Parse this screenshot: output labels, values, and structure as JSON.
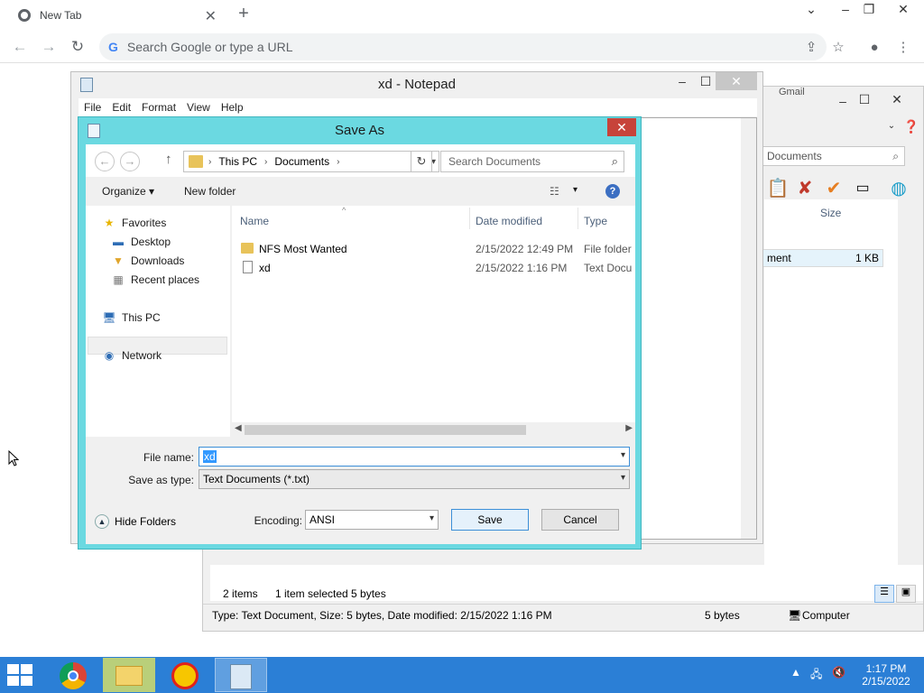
{
  "chrome": {
    "tab_title": "New Tab",
    "omnibox_placeholder": "Search Google or type a URL",
    "customize_label": "Customize Chrome",
    "partial_text": "Gmail"
  },
  "explorer": {
    "search_text": "Documents",
    "col_size": "Size",
    "row_name": "ment",
    "row_size": "1 KB",
    "items_count": "2 items",
    "selection": "1 item selected  5 bytes",
    "status_type": "Type: Text Document, Size: 5 bytes, Date modified: 2/15/2022 1:16 PM",
    "status_size": "5 bytes",
    "status_location": "Computer"
  },
  "notepad": {
    "title": "xd - Notepad",
    "menu": [
      "File",
      "Edit",
      "Format",
      "View",
      "Help"
    ]
  },
  "saveas": {
    "title": "Save As",
    "breadcrumb": [
      "This PC",
      "Documents"
    ],
    "search_placeholder": "Search Documents",
    "organize": "Organize",
    "new_folder": "New folder",
    "tree": {
      "favorites": "Favorites",
      "desktop": "Desktop",
      "downloads": "Downloads",
      "recent": "Recent places",
      "thispc": "This PC",
      "network": "Network"
    },
    "columns": {
      "name": "Name",
      "date": "Date modified",
      "type": "Type"
    },
    "files": [
      {
        "name": "NFS Most Wanted",
        "date": "2/15/2022 12:49 PM",
        "type": "File folder"
      },
      {
        "name": "xd",
        "date": "2/15/2022 1:16 PM",
        "type": "Text Docu"
      }
    ],
    "file_name_label": "File name:",
    "file_name_value": "xd",
    "save_type_label": "Save as type:",
    "save_type_value": "Text Documents (*.txt)",
    "hide_folders": "Hide Folders",
    "encoding_label": "Encoding:",
    "encoding_value": "ANSI",
    "save_button": "Save",
    "cancel_button": "Cancel"
  },
  "taskbar": {
    "time": "1:17 PM",
    "date": "2/15/2022"
  }
}
